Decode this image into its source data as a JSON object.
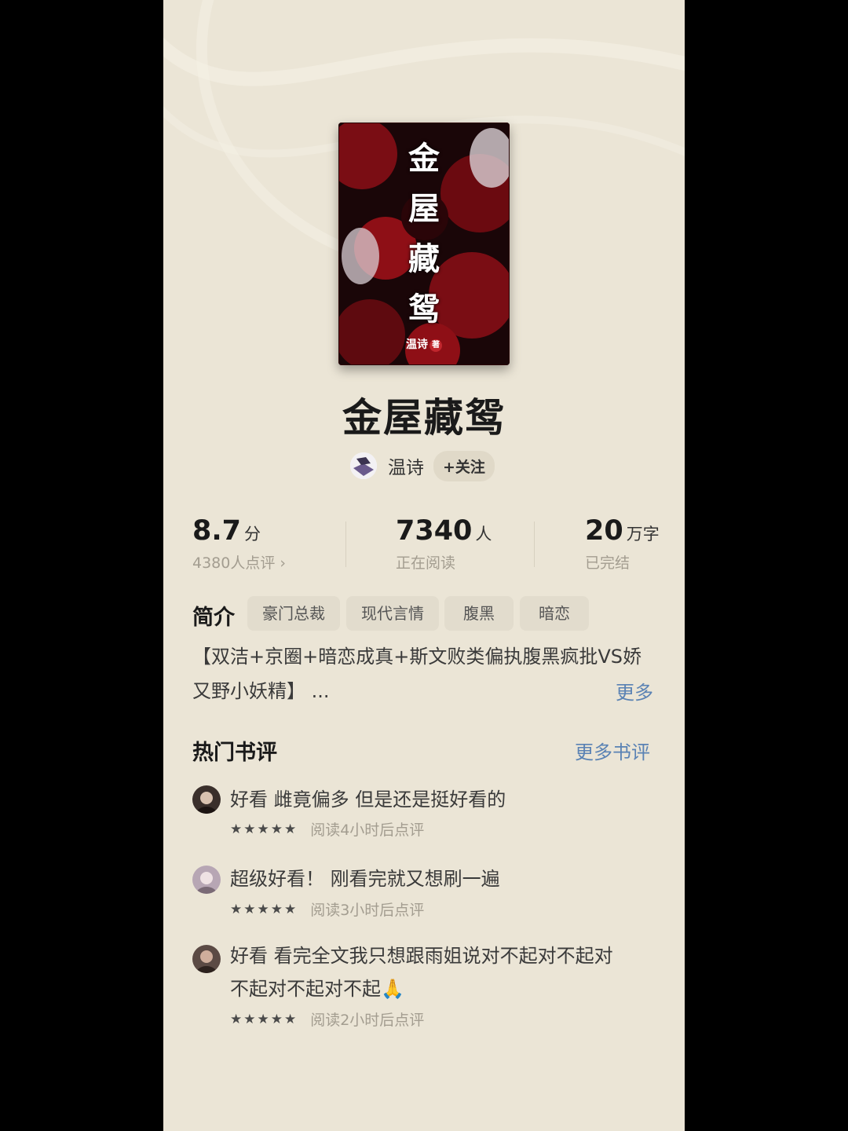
{
  "book": {
    "cover_title_chars": [
      "金",
      "屋",
      "藏",
      "鸳"
    ],
    "cover_author": "温诗",
    "cover_author_badge": "著",
    "title": "金屋藏鸳",
    "author": "温诗",
    "follow_label": "+关注"
  },
  "stats": {
    "rating": {
      "value": "8.7",
      "unit": "分",
      "sub": "4380人点评 ›"
    },
    "readers": {
      "value": "7340",
      "unit": "人",
      "sub": "正在阅读"
    },
    "words": {
      "value": "20",
      "unit": "万字",
      "sub": "已完结"
    }
  },
  "intro": {
    "label": "简介",
    "tags": [
      "豪门总裁",
      "现代言情",
      "腹黑",
      "暗恋"
    ],
    "text_line1": "【双洁+京圈+暗恋成真+斯文败类偏执腹黑疯批VS娇",
    "text_line2": "又野小妖精】 ...",
    "more_label": "更多"
  },
  "reviews": {
    "title": "热门书评",
    "more_label": "更多书评",
    "items": [
      {
        "text": "好看 雌竟偏多 但是还是挺好看的",
        "stars": "★★★★★",
        "meta": "阅读4小时后点评"
      },
      {
        "text": "超级好看！ 刚看完就又想刷一遍",
        "stars": "★★★★★",
        "meta": "阅读3小时后点评"
      },
      {
        "text_line1": "好看 看完全文我只想跟雨姐说对不起对不起对",
        "text_line2": "不起对不起对不起🙏",
        "stars": "★★★★★",
        "meta": "阅读2小时后点评"
      }
    ]
  },
  "colors": {
    "background": "#ebe5d6",
    "link": "#5a82b4",
    "cover_red": "#8e0f16"
  }
}
